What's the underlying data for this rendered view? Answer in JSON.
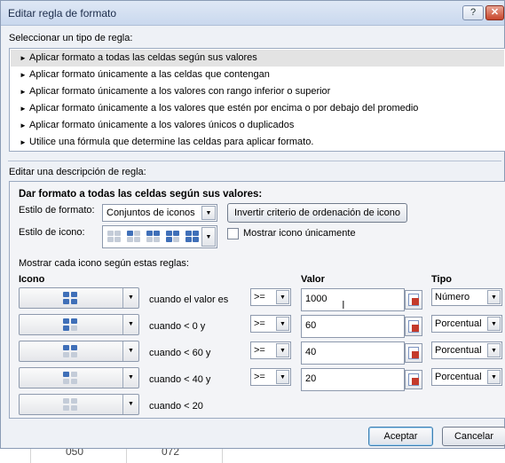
{
  "window": {
    "title": "Editar regla de formato",
    "help_label": "?",
    "close_label": "✕"
  },
  "rule_type": {
    "label": "Seleccionar un tipo de regla:",
    "items": [
      "Aplicar formato a todas las celdas según sus valores",
      "Aplicar formato únicamente a las celdas que contengan",
      "Aplicar formato únicamente a los valores con rango inferior o superior",
      "Aplicar formato únicamente a los valores que estén por encima o por debajo del promedio",
      "Aplicar formato únicamente a los valores únicos o duplicados",
      "Utilice una fórmula que determine las celdas para aplicar formato."
    ],
    "selected_index": 0
  },
  "description": {
    "label": "Editar una descripción de regla:",
    "heading": "Dar formato a todas las celdas según sus valores:",
    "format_style_label": "Estilo de formato:",
    "format_style_value": "Conjuntos de iconos",
    "reverse_button": "Invertir criterio de ordenación de icono",
    "icon_style_label": "Estilo de icono:",
    "show_icon_only_label": "Mostrar icono únicamente",
    "show_icon_only_checked": false,
    "rules_label": "Mostrar cada icono según estas reglas:",
    "col_icon": "Icono",
    "col_value": "Valor",
    "col_type": "Tipo",
    "rules": [
      {
        "condition": "cuando el valor es",
        "operator": ">=",
        "value": "1000",
        "type": "Número"
      },
      {
        "condition": "cuando < 0 y",
        "operator": ">=",
        "value": "60",
        "type": "Porcentual"
      },
      {
        "condition": "cuando < 60 y",
        "operator": ">=",
        "value": "40",
        "type": "Porcentual"
      },
      {
        "condition": "cuando < 40 y",
        "operator": ">=",
        "value": "20",
        "type": "Porcentual"
      },
      {
        "condition": "cuando < 20"
      }
    ]
  },
  "footer": {
    "accept_label": "Aceptar",
    "cancel_label": "Cancelar"
  },
  "sheet": {
    "cells": [
      "050",
      "072"
    ]
  },
  "colors": {
    "accent": "#3f6fb8",
    "list_selected": "#e3e3e3",
    "panel": "#eef1f6"
  }
}
